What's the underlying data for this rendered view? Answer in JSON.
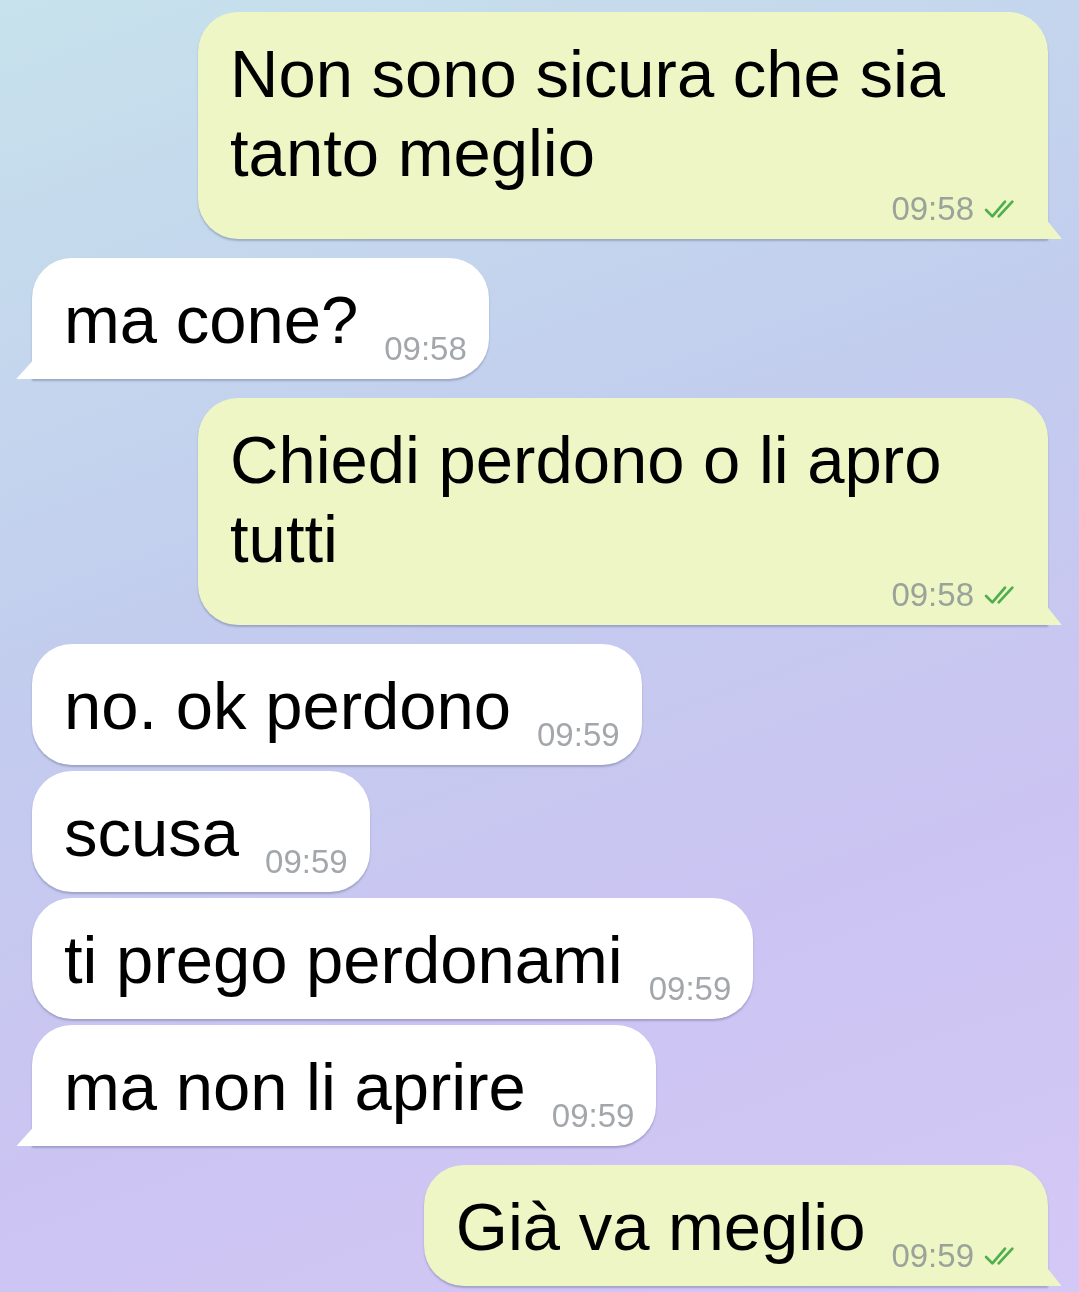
{
  "messages": [
    {
      "kind": "outgoing",
      "text": "Non sono sicura che sia tanto meglio",
      "time": "09:58",
      "read": true,
      "tail": true
    },
    {
      "kind": "incoming",
      "text": "ma cone?",
      "time": "09:58",
      "tail": true
    },
    {
      "kind": "outgoing",
      "text": "Chiedi perdono o li apro tutti",
      "time": "09:58",
      "read": true,
      "tail": true
    },
    {
      "kind": "incoming",
      "text": "no. ok perdono",
      "time": "09:59",
      "tail": false
    },
    {
      "kind": "incoming",
      "text": "scusa",
      "time": "09:59",
      "tail": false
    },
    {
      "kind": "incoming",
      "text": "ti prego perdonami",
      "time": "09:59",
      "tail": false
    },
    {
      "kind": "incoming",
      "text": "ma non li aprire",
      "time": "09:59",
      "tail": true
    },
    {
      "kind": "outgoing",
      "text": "Già va meglio",
      "time": "09:59",
      "read": true,
      "tail": true
    }
  ]
}
